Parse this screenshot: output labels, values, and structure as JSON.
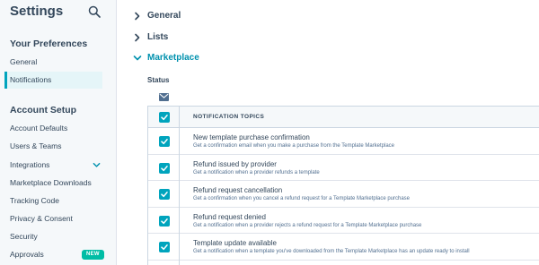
{
  "sidebar": {
    "title": "Settings",
    "search_icon": "search-icon",
    "preferences_heading": "Your Preferences",
    "preferences_items": [
      {
        "label": "General"
      },
      {
        "label": "Notifications"
      }
    ],
    "account_heading": "Account Setup",
    "account_items": [
      {
        "label": "Account Defaults"
      },
      {
        "label": "Users & Teams"
      },
      {
        "label": "Integrations"
      },
      {
        "label": "Marketplace Downloads"
      },
      {
        "label": "Tracking Code"
      },
      {
        "label": "Privacy & Consent"
      },
      {
        "label": "Security"
      },
      {
        "label": "Approvals",
        "badge": "NEW"
      }
    ],
    "active_item": "Notifications"
  },
  "main": {
    "sections": [
      {
        "label": "General",
        "expanded": false
      },
      {
        "label": "Lists",
        "expanded": false
      },
      {
        "label": "Marketplace",
        "expanded": true
      }
    ],
    "status_label": "Status",
    "channel_icon": "mail-icon",
    "table": {
      "header": "NOTIFICATION TOPICS",
      "header_checked": true,
      "rows": [
        {
          "title": "New template purchase confirmation",
          "description": "Get a confirmation email when you make a purchase from the Template Marketplace",
          "checked": true
        },
        {
          "title": "Refund issued by provider",
          "description": "Get a notification when a provider refunds a template",
          "checked": true
        },
        {
          "title": "Refund request cancellation",
          "description": "Get a confirmation when you cancel a refund request for a Template Marketplace purchase",
          "checked": true
        },
        {
          "title": "Refund request denied",
          "description": "Get a notification when a provider rejects a refund request for a Template Marketplace purchase",
          "checked": true
        },
        {
          "title": "Template update available",
          "description": "Get a notification when a template you've downloaded from the Template Marketplace has an update ready to install",
          "checked": true
        }
      ]
    }
  },
  "colors": {
    "accent": "#00a4bd",
    "active_bg": "#e5f5f8",
    "badge": "#00bda5",
    "text": "#33475b"
  }
}
